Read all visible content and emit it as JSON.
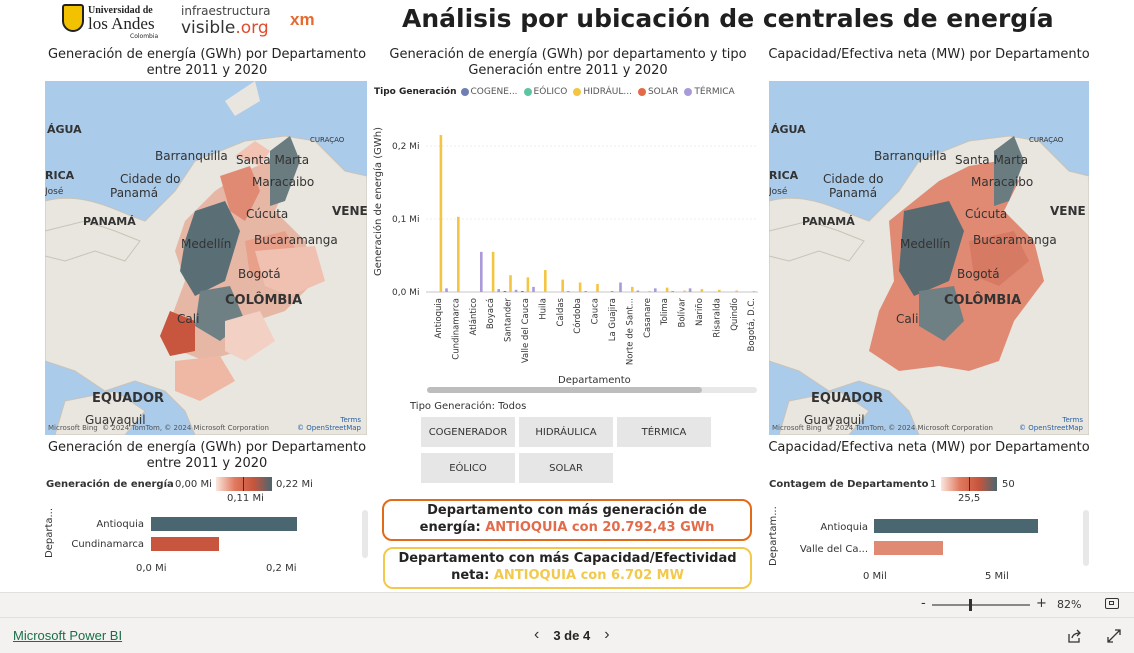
{
  "header": {
    "title": "Análisis por ubicación de centrales de energía",
    "logo_ua": {
      "line1": "Universidad de",
      "line2": "los Andes",
      "line3": "Colombia"
    },
    "logo_iv": {
      "line1": "infraestructura",
      "line2a": "visible",
      "line2b": ".org"
    },
    "logo_xm": "xm"
  },
  "colors": {
    "teal": "#4a6670",
    "red": "#c8553d",
    "salmon": "#e08a74",
    "yellow": "#f4c542",
    "purple": "#a99ad9",
    "orange_border": "#e06b1a",
    "yellow_border": "#f2c94c",
    "callout_red": "#e36b4a",
    "callout_yellow": "#f2c94c"
  },
  "map_left": {
    "title": "Generación de energía (GWh) por Departamento entre 2011 y 2020",
    "labels": [
      "ÁGUA",
      "Barranquilla",
      "Santa Marta",
      "CURAÇAO",
      "RICA",
      "Cidade do",
      "Panamá",
      "Maracaibo",
      "José",
      "PANAMÁ",
      "Cúcuta",
      "VENE",
      "Medellín",
      "Bucaramanga",
      "Bogotá",
      "COLÔMBIA",
      "Cali",
      "EQUADOR",
      "Guayaquil"
    ],
    "attribution": "© 2024 TomTom, © 2024 Microsoft Corporation",
    "terms": "Terms",
    "osm": "© OpenStreetMap",
    "bing": "Microsoft Bing"
  },
  "map_right": {
    "title": "Capacidad/Efectiva neta (MW) por Departamento",
    "labels": [
      "ÁGUA",
      "Barranquilla",
      "Santa Marta",
      "CURAÇAO",
      "RICA",
      "Cidade do",
      "Panamá",
      "Maracaibo",
      "José",
      "PANAMÁ",
      "Cúcuta",
      "VENE",
      "Medellín",
      "Bucaramanga",
      "Bogotá",
      "COLÔMBIA",
      "Cali",
      "EQUADOR",
      "Guayaquil"
    ],
    "attribution": "© 2024 TomTom, © 2024 Microsoft Corporation",
    "terms": "Terms",
    "osm": "© OpenStreetMap",
    "bing": "Microsoft Bing"
  },
  "bar_chart": {
    "title_line1": "Generación de energía (GWh) por departamento y tipo",
    "title_line2": "Generación entre 2011 y 2020",
    "legend_title": "Tipo Generación",
    "legend": [
      {
        "name": "COGENE...",
        "color": "#6f7fb4"
      },
      {
        "name": "EÓLICO",
        "color": "#5fc4a4"
      },
      {
        "name": "HIDRÁUL...",
        "color": "#f4c542"
      },
      {
        "name": "SOLAR",
        "color": "#e36b4a"
      },
      {
        "name": "TÉRMICA",
        "color": "#a99ad9"
      }
    ],
    "y_title": "Generación de energía (GWh)",
    "x_title": "Departamento",
    "y_ticks": [
      "0,2 Mi",
      "0,1 Mi",
      "0,0 Mi"
    ]
  },
  "chart_data": {
    "type": "bar",
    "title": "Generación de energía (GWh) por departamento y tipo Generación entre 2011 y 2020",
    "xlabel": "Departamento",
    "ylabel": "Generación de energía (GWh)",
    "ylim": [
      0,
      0.2
    ],
    "y_unit": "Mi",
    "categories": [
      "Antioquia",
      "Cundinamarca",
      "Atlántico",
      "Boyacá",
      "Santander",
      "Valle del Cauca",
      "Huila",
      "Caldas",
      "Córdoba",
      "Cauca",
      "La Guajira",
      "Norte de Sant...",
      "Casanare",
      "Tolima",
      "Bolívar",
      "Nariño",
      "Risaralda",
      "Quindío",
      "Bogotá, D.C."
    ],
    "series": [
      {
        "name": "COGENE...",
        "values": [
          0,
          0,
          0,
          0,
          0.001,
          0.001,
          0,
          0,
          0,
          0,
          0,
          0,
          0,
          0,
          0,
          0,
          0,
          0,
          0
        ]
      },
      {
        "name": "EÓLICO",
        "values": [
          0,
          0,
          0,
          0,
          0,
          0,
          0,
          0,
          0,
          0,
          0.001,
          0,
          0,
          0,
          0,
          0,
          0,
          0,
          0
        ]
      },
      {
        "name": "HIDRÁUL...",
        "values": [
          0.215,
          0.103,
          0,
          0.055,
          0.023,
          0.02,
          0.03,
          0.017,
          0.013,
          0.011,
          0,
          0.007,
          0.001,
          0.006,
          0.002,
          0.004,
          0.003,
          0.002,
          0.001
        ]
      },
      {
        "name": "SOLAR",
        "values": [
          0,
          0,
          0,
          0,
          0,
          0,
          0,
          0,
          0,
          0,
          0,
          0,
          0,
          0,
          0,
          0,
          0,
          0,
          0
        ]
      },
      {
        "name": "TÉRMICA",
        "values": [
          0.005,
          0,
          0.055,
          0.004,
          0.003,
          0.007,
          0,
          0.001,
          0.001,
          0,
          0.013,
          0.002,
          0.005,
          0.001,
          0.005,
          0,
          0,
          0,
          0.001
        ]
      }
    ]
  },
  "slicer": {
    "header": "Tipo Generación: Todos",
    "buttons": [
      "COGENERADOR",
      "HIDRÁULICA",
      "TÉRMICA",
      "EÓLICO",
      "SOLAR"
    ]
  },
  "callout_gen": {
    "line1": "Departamento con más generación de",
    "line2_prefix": "energía: ",
    "line2_value": "ANTIOQUIA con 20.792,43 GWh"
  },
  "callout_cap": {
    "line1": "Departamento con más Capacidad/Efectividad",
    "line2_prefix": "neta: ",
    "line2_value": "ANTIOQUIA con 6.702 MW"
  },
  "bars_left": {
    "title": "Generación de energía (GWh) por Departamento entre 2011 y 2020",
    "legend_label": "Generación de energía",
    "legend_min": "0,00 Mi",
    "legend_mid": "0,11 Mi",
    "legend_max": "0,22 Mi",
    "axis_title": "Departa...",
    "categories": [
      "Antioquia",
      "Cundinamarca"
    ],
    "x_ticks": [
      "0,0 Mi",
      "0,2 Mi"
    ]
  },
  "bars_right": {
    "title": "Capacidad/Efectiva neta (MW) por Departamento",
    "legend_label": "Contagem de Departamento",
    "legend_min": "1",
    "legend_mid": "25,5",
    "legend_max": "50",
    "axis_title": "Departam...",
    "categories": [
      "Antioquia",
      "Valle del Ca..."
    ],
    "x_ticks": [
      "0 Mil",
      "5 Mil"
    ]
  },
  "zoom": {
    "minus": "-",
    "plus": "+",
    "level": "82%"
  },
  "footer": {
    "brand": "Microsoft Power BI",
    "page": "3 de 4",
    "prev": "‹",
    "next": "›"
  }
}
